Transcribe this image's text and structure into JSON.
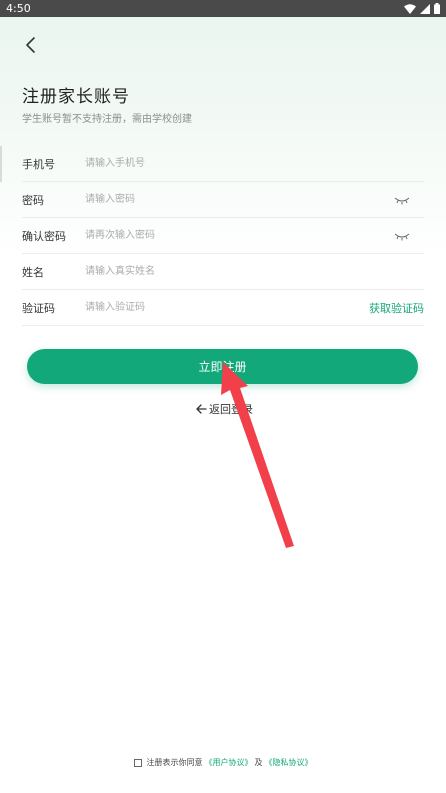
{
  "status_bar": {
    "time": "4:50"
  },
  "page": {
    "title": "注册家长账号",
    "subtitle": "学生账号暂不支持注册，需由学校创建"
  },
  "form": {
    "phone": {
      "label": "手机号",
      "placeholder": "请输入手机号"
    },
    "password": {
      "label": "密码",
      "placeholder": "请输入密码"
    },
    "confirm_password": {
      "label": "确认密码",
      "placeholder": "请再次输入密码"
    },
    "name": {
      "label": "姓名",
      "placeholder": "请输入真实姓名"
    },
    "code": {
      "label": "验证码",
      "placeholder": "请输入验证码",
      "get_code_label": "获取验证码"
    }
  },
  "actions": {
    "submit_label": "立即注册",
    "back_login_label": "返回登录"
  },
  "agreement": {
    "prefix": "注册表示你同意",
    "user_agreement": "《用户协议》",
    "and": "及",
    "privacy_agreement": "《隐私协议》"
  },
  "colors": {
    "accent": "#12a87a",
    "annotation_arrow": "#f2404a"
  }
}
